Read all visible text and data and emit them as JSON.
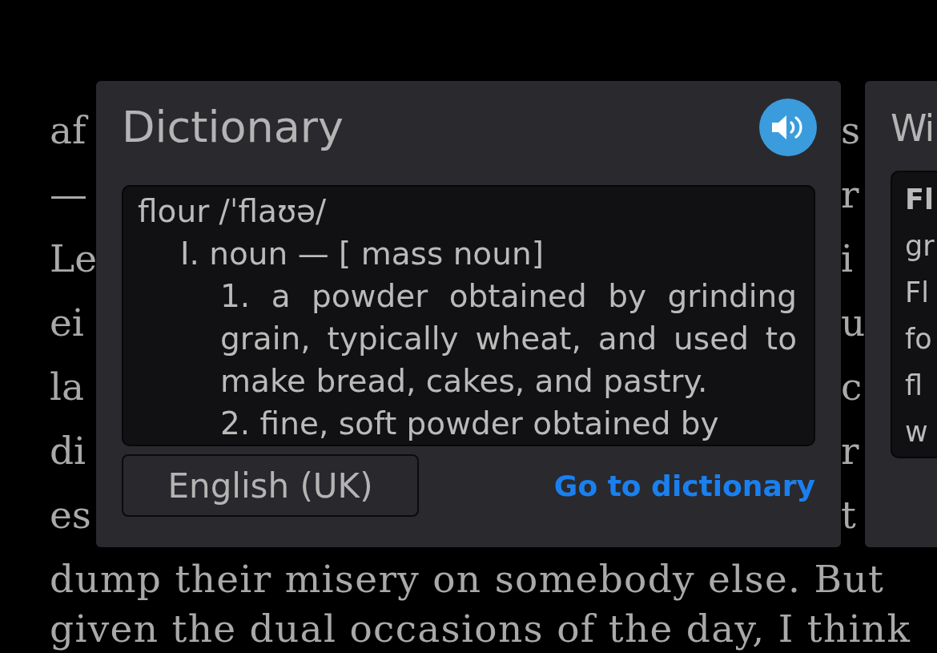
{
  "book_page": {
    "covered_lines": [
      {
        "left": "af",
        "right": "s"
      },
      {
        "left": "—",
        "right": "r"
      },
      {
        "left": "Le",
        "right": "i"
      },
      {
        "left": "ei",
        "right": "u"
      },
      {
        "left": "la",
        "right": "c"
      },
      {
        "left": "di",
        "right": "r"
      },
      {
        "left": "es",
        "right": "t"
      }
    ],
    "lines": [
      "dump their misery on somebody else. But",
      "given the dual occasions of the day, I think"
    ]
  },
  "dictionary_popup": {
    "title": "Dictionary",
    "entry": "flour /ˈflaʊə/",
    "part_of_speech": "I. noun — [ mass noun]",
    "senses": [
      "1. a powder obtained by grinding grain, typically wheat, and used to make bread, cakes, and pastry.",
      "2. fine, soft powder obtained by"
    ],
    "language_button": "English (UK)",
    "link": "Go to dictionary"
  },
  "wikipedia_popup": {
    "title": "Wi",
    "lines": [
      {
        "text": "Fl",
        "bold": true
      },
      {
        "text": "gr",
        "bold": false
      },
      {
        "text": "Fl",
        "bold": false
      },
      {
        "text": "fo",
        "bold": false
      },
      {
        "text": "fl",
        "bold": false
      },
      {
        "text": "w",
        "bold": false
      }
    ]
  }
}
